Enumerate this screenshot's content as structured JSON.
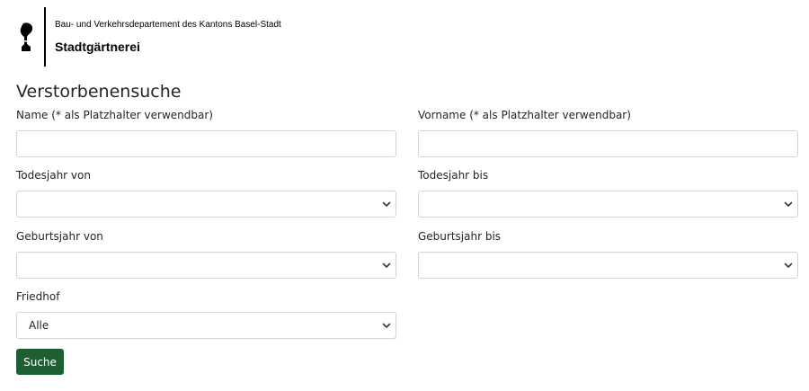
{
  "header": {
    "department": "Bau- und Verkehrsdepartement des Kantons Basel-Stadt",
    "unit": "Stadtgärtnerei",
    "logo": "basel-baselstab-logo"
  },
  "page": {
    "title": "Verstorbenensuche"
  },
  "form": {
    "name": {
      "label": "Name (* als Platzhalter verwendbar)",
      "value": "",
      "placeholder": ""
    },
    "vorname": {
      "label": "Vorname (* als Platzhalter verwendbar)",
      "value": "",
      "placeholder": ""
    },
    "todesjahr_von": {
      "label": "Todesjahr von",
      "selected": ""
    },
    "todesjahr_bis": {
      "label": "Todesjahr bis",
      "selected": ""
    },
    "geburtsjahr_von": {
      "label": "Geburtsjahr von",
      "selected": ""
    },
    "geburtsjahr_bis": {
      "label": "Geburtsjahr bis",
      "selected": ""
    },
    "friedhof": {
      "label": "Friedhof",
      "selected": "Alle"
    },
    "submit_label": "Suche"
  },
  "colors": {
    "button": "#1e5e33",
    "border": "#ced4da",
    "text": "#212529"
  },
  "icons": {
    "select_arrow": "chevron-down-icon"
  }
}
